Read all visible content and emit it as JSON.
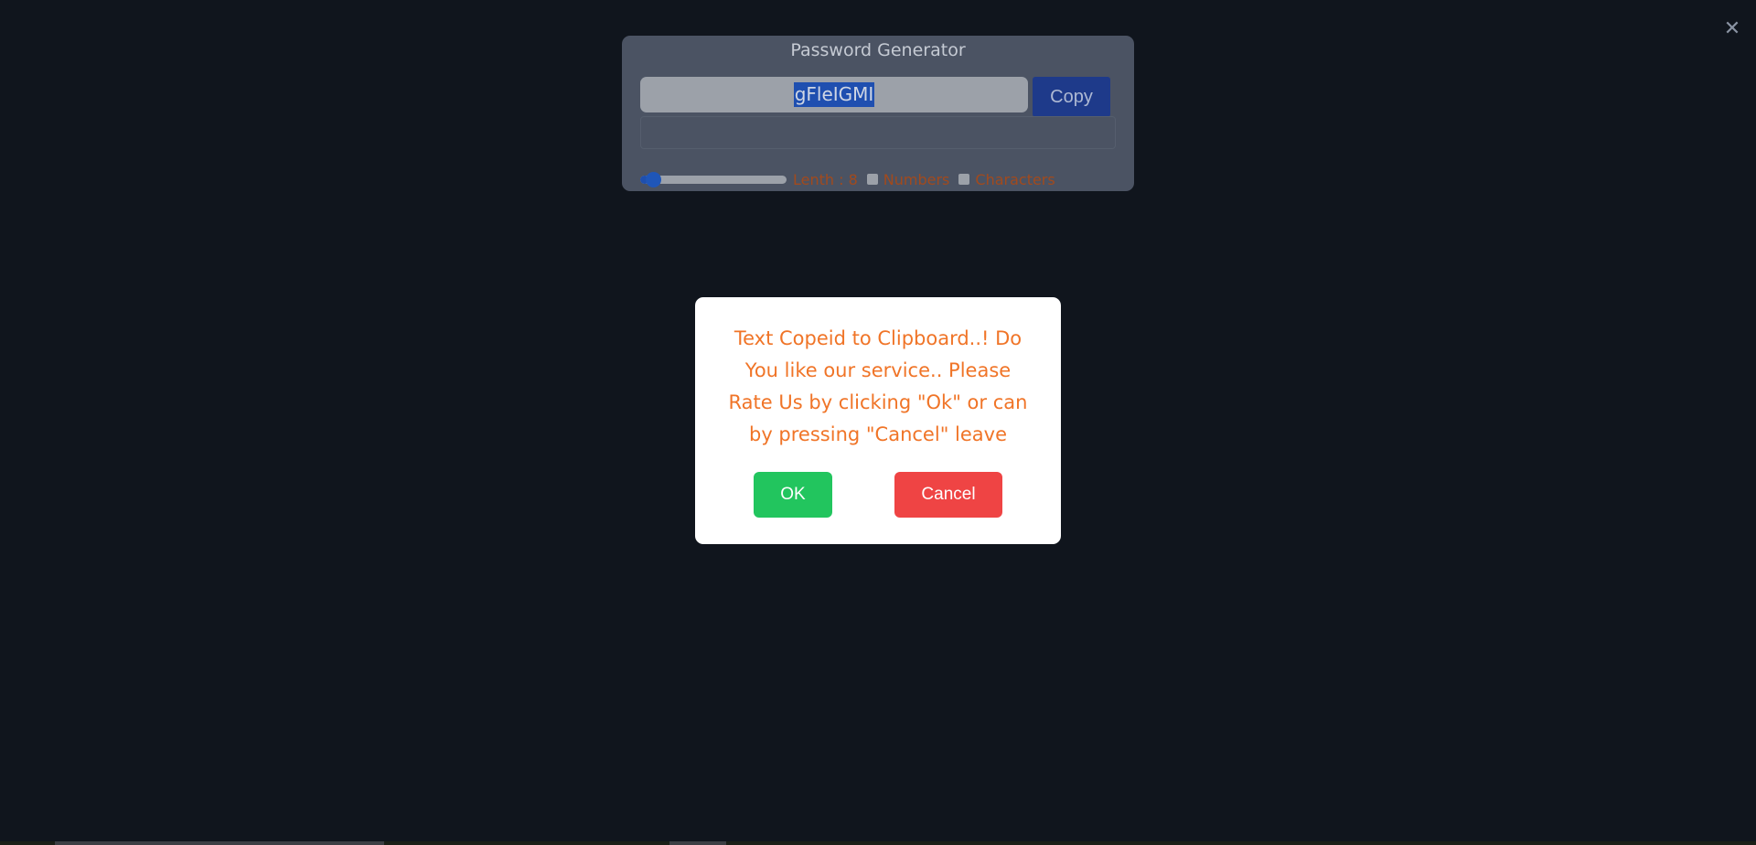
{
  "window": {
    "close_glyph": "✕"
  },
  "generator": {
    "title": "Password Generator",
    "password_value": "gFleIGMI",
    "copy_label": "Copy",
    "length_label": "Lenth : 8",
    "length_value": 8,
    "length_fraction": 0.06,
    "numbers_label": "Numbers",
    "numbers_checked": false,
    "characters_label": "Characters",
    "characters_checked": false
  },
  "dialog": {
    "message": "Text Copeid to Clipboard..! Do You like our service.. Please Rate Us by clicking \"Ok\" or can by pressing \"Cancel\" leave",
    "ok_label": "OK",
    "cancel_label": "Cancel"
  },
  "colors": {
    "background": "#10151d",
    "card": "#4b5363",
    "accent_blue": "#1e3a8a",
    "message_orange": "#f07427",
    "ok_green": "#22c55e",
    "cancel_red": "#ef4444"
  }
}
